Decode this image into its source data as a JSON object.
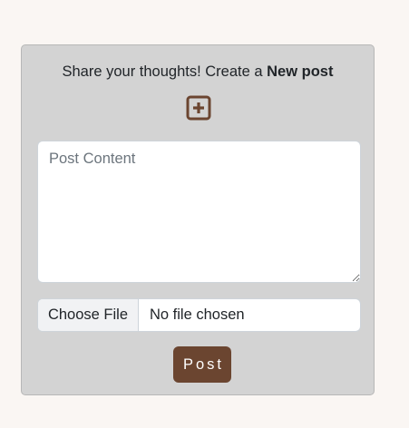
{
  "new_post": {
    "headline_prefix": "Share your thoughts! Create a ",
    "headline_bold": "New post",
    "add_icon": "plus-square-icon",
    "content_placeholder": "Post Content",
    "content_value": "",
    "file_button_label": "Choose File",
    "file_status": "No file chosen",
    "submit_label": "Post"
  },
  "colors": {
    "page_background": "#faf6f3",
    "card_background": "#d3d3d3",
    "accent_brown": "#6b4530"
  }
}
